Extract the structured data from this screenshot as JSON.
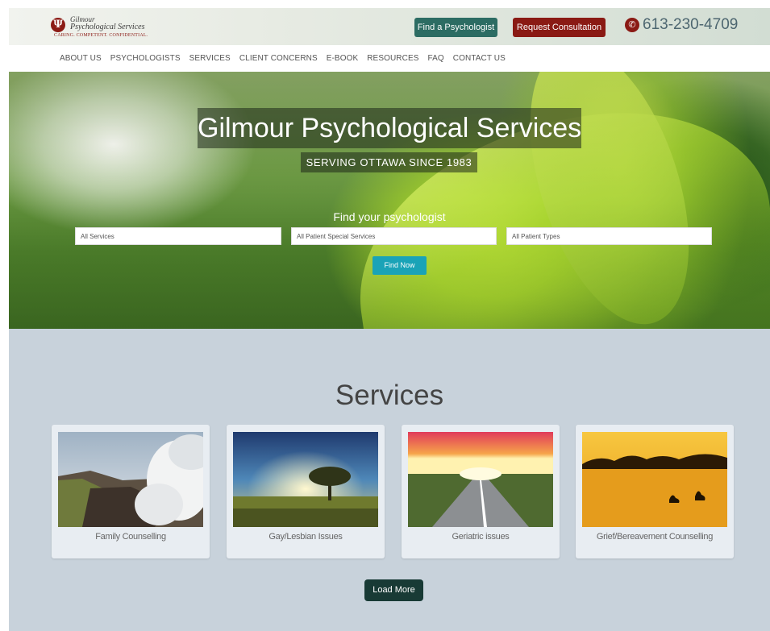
{
  "header": {
    "logo_line1": "Gilmour",
    "logo_line2": "Psychological Services",
    "logo_tagline": "CARING. COMPETENT. CONFIDENTIAL.",
    "find_psychologist_label": "Find a Psychologist",
    "request_consultation_label": "Request Consultation",
    "phone": "613-230-4709",
    "phone_icon": "phone-icon",
    "brand_color": "#8a1a14",
    "accent_color": "#2c6c63"
  },
  "nav": {
    "items": [
      "ABOUT US",
      "PSYCHOLOGISTS",
      "SERVICES",
      "CLIENT CONCERNS",
      "E-BOOK",
      "RESOURCES",
      "FAQ",
      "CONTACT US"
    ]
  },
  "hero": {
    "title": "Gilmour Psychological Services",
    "subtitle": "SERVING OTTAWA SINCE 1983",
    "find_label": "Find your psychologist",
    "selects": [
      "All Services",
      "All Patient Special Services",
      "All Patient Types"
    ],
    "find_now_label": "Find Now"
  },
  "services": {
    "heading": "Services",
    "cards": [
      {
        "label": "Family Counselling",
        "image": "volcano-landscape"
      },
      {
        "label": "Gay/Lesbian Issues",
        "image": "tree-sunset"
      },
      {
        "label": "Geriatric issues",
        "image": "road-sunset"
      },
      {
        "label": "Grief/Bereavement Counselling",
        "image": "geese-lake"
      }
    ],
    "load_more_label": "Load More"
  }
}
